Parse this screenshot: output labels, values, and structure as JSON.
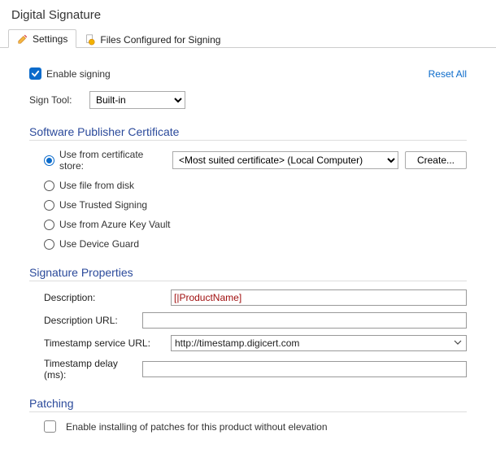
{
  "title": "Digital Signature",
  "tabs": {
    "settings": "Settings",
    "files": "Files Configured for Signing"
  },
  "enable_label": "Enable signing",
  "reset_link": "Reset All",
  "sign_tool": {
    "label": "Sign Tool:",
    "value": "Built-in"
  },
  "cert_section": {
    "title": "Software Publisher Certificate",
    "opt_store": "Use from certificate store:",
    "opt_file": "Use file from disk",
    "opt_trusted": "Use Trusted Signing",
    "opt_azure": "Use from Azure Key Vault",
    "opt_device": "Use Device Guard",
    "store_value": "<Most suited certificate> (Local Computer)",
    "create_btn": "Create..."
  },
  "sig_props": {
    "title": "Signature Properties",
    "desc_label": "Description:",
    "desc_value": "[|ProductName]",
    "desc_url_label": "Description URL:",
    "desc_url_value": "",
    "ts_url_label": "Timestamp service URL:",
    "ts_url_value": "http://timestamp.digicert.com",
    "ts_delay_label": "Timestamp delay (ms):",
    "ts_delay_value": ""
  },
  "patching": {
    "title": "Patching",
    "enable_label": "Enable installing of patches for this product without elevation"
  }
}
